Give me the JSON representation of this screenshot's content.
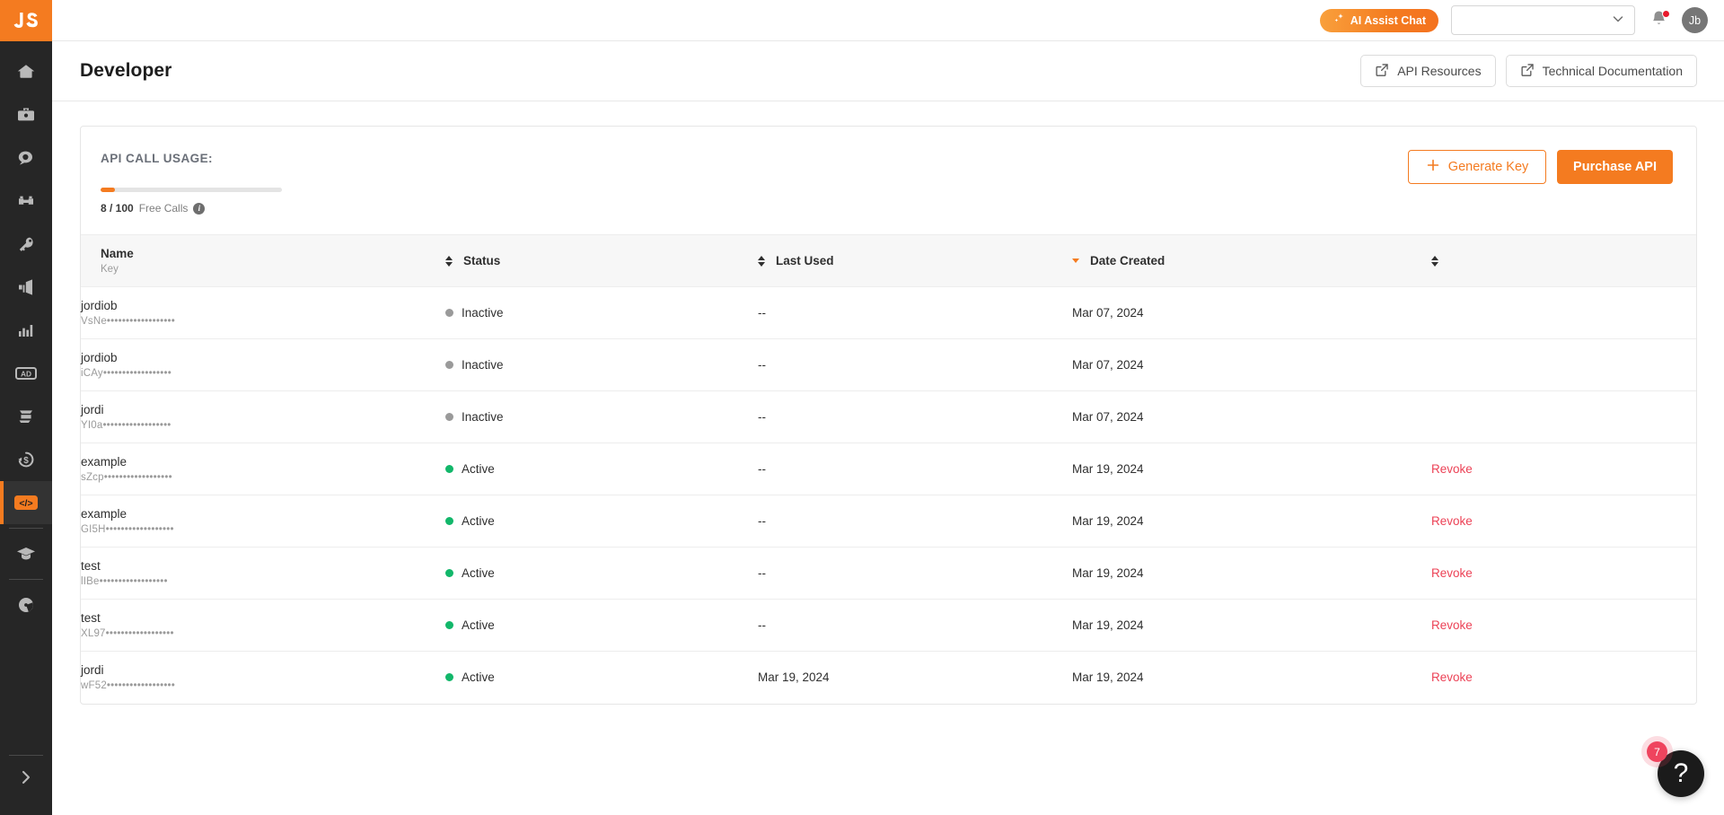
{
  "sidebar": {
    "logo_text": "JS",
    "items": [
      {
        "name": "home",
        "icon": "home-icon",
        "active": false
      },
      {
        "name": "briefcase",
        "icon": "briefcase-icon",
        "active": false
      },
      {
        "name": "search-insights",
        "icon": "magnifier-icon",
        "active": false
      },
      {
        "name": "binoculars",
        "icon": "binoculars-icon",
        "active": false
      },
      {
        "name": "keywords",
        "icon": "key-icon",
        "active": false
      },
      {
        "name": "advertising",
        "icon": "megaphone-icon",
        "active": false
      },
      {
        "name": "analytics",
        "icon": "bar-chart-icon",
        "active": false
      },
      {
        "name": "ads",
        "icon": "ad-badge-icon",
        "active": false
      },
      {
        "name": "inventory",
        "icon": "box-exchange-icon",
        "active": false
      },
      {
        "name": "finance",
        "icon": "dollar-refresh-icon",
        "active": false
      },
      {
        "name": "developer",
        "icon": "code-icon",
        "active": true
      },
      {
        "name": "academy",
        "icon": "graduation-cap-icon",
        "active": false
      },
      {
        "name": "community",
        "icon": "pie-globe-icon",
        "active": false
      }
    ],
    "expand_icon": "chevron-right-icon"
  },
  "topbar": {
    "ai_assist_label": "AI Assist Chat",
    "ai_assist_icon": "sparkle-icon",
    "account_select_value": "",
    "account_select_placeholder": "",
    "chevron_icon": "chevron-down-icon",
    "bell_icon": "bell-icon",
    "has_notification": true,
    "avatar_initials": "Jb"
  },
  "page": {
    "title": "Developer",
    "buttons": [
      {
        "label": "API Resources",
        "icon": "external-link-icon"
      },
      {
        "label": "Technical Documentation",
        "icon": "external-link-icon"
      }
    ]
  },
  "usage": {
    "title": "API CALL USAGE:",
    "used": 8,
    "total": 100,
    "progress_percent": 8,
    "count_label": "8 / 100",
    "unit_label": "Free Calls",
    "info_icon": "info-icon",
    "generate_key_label": "Generate Key",
    "generate_key_icon": "plus-icon",
    "purchase_api_label": "Purchase API"
  },
  "table": {
    "columns": [
      {
        "label": "Name",
        "sublabel": "Key",
        "sortable": true,
        "sort": "none"
      },
      {
        "label": "Status",
        "sortable": true,
        "sort": "none"
      },
      {
        "label": "Last Used",
        "sortable": true,
        "sort": "desc"
      },
      {
        "label": "Date Created",
        "sortable": true,
        "sort": "none"
      }
    ],
    "rows": [
      {
        "name": "jordiob",
        "key": "VsNe••••••••••••••••••",
        "status": "Inactive",
        "status_state": "inactive",
        "last_used": "--",
        "date_created": "Mar 07, 2024",
        "action": ""
      },
      {
        "name": "jordiob",
        "key": "iCAy••••••••••••••••••",
        "status": "Inactive",
        "status_state": "inactive",
        "last_used": "--",
        "date_created": "Mar 07, 2024",
        "action": ""
      },
      {
        "name": "jordi",
        "key": "YI0a••••••••••••••••••",
        "status": "Inactive",
        "status_state": "inactive",
        "last_used": "--",
        "date_created": "Mar 07, 2024",
        "action": ""
      },
      {
        "name": "example",
        "key": "sZcp••••••••••••••••••",
        "status": "Active",
        "status_state": "active",
        "last_used": "--",
        "date_created": "Mar 19, 2024",
        "action": "Revoke"
      },
      {
        "name": "example",
        "key": "GI5H••••••••••••••••••",
        "status": "Active",
        "status_state": "active",
        "last_used": "--",
        "date_created": "Mar 19, 2024",
        "action": "Revoke"
      },
      {
        "name": "test",
        "key": "lIBe••••••••••••••••••",
        "status": "Active",
        "status_state": "active",
        "last_used": "--",
        "date_created": "Mar 19, 2024",
        "action": "Revoke"
      },
      {
        "name": "test",
        "key": "XL97••••••••••••••••••",
        "status": "Active",
        "status_state": "active",
        "last_used": "--",
        "date_created": "Mar 19, 2024",
        "action": "Revoke"
      },
      {
        "name": "jordi",
        "key": "wF52••••••••••••••••••",
        "status": "Active",
        "status_state": "active",
        "last_used": "Mar 19, 2024",
        "date_created": "Mar 19, 2024",
        "action": "Revoke"
      }
    ]
  },
  "help": {
    "icon": "question-mark-icon",
    "badge_count": "7"
  },
  "colors": {
    "brand_orange": "#f47b20",
    "sidebar_dark": "#262626",
    "status_active": "#12b76a",
    "status_inactive": "#9a9a9a",
    "revoke_red": "#ec4256",
    "badge_red": "#ef445e"
  }
}
